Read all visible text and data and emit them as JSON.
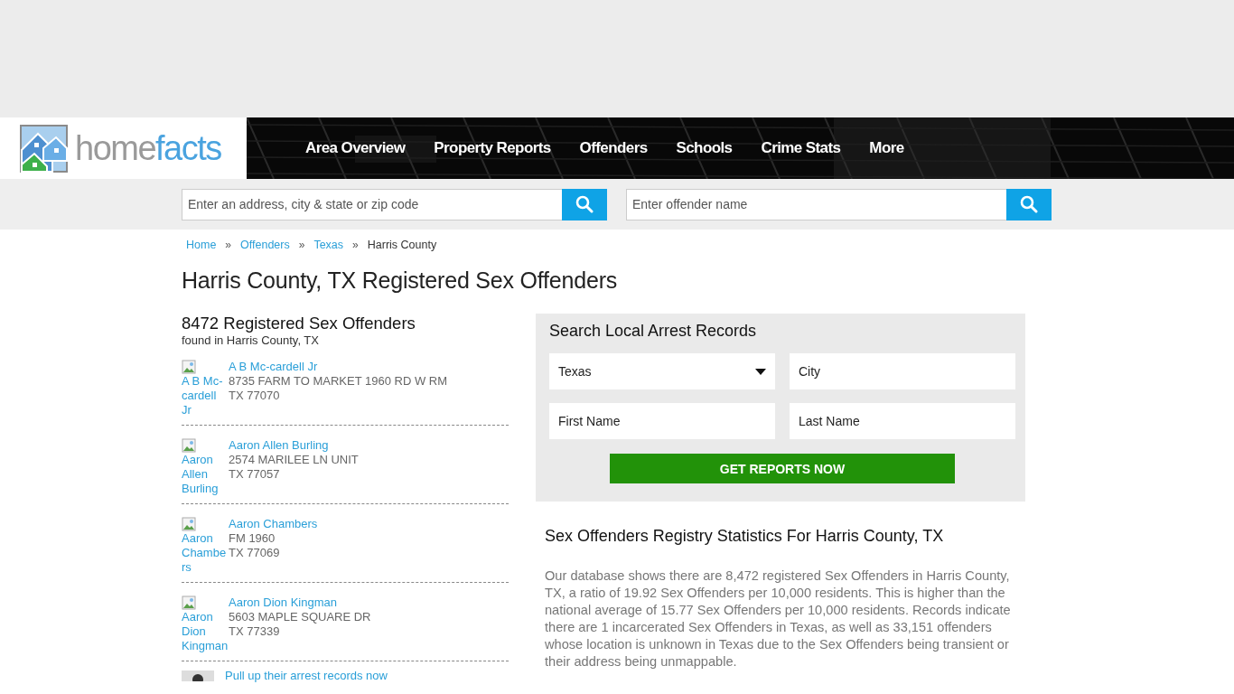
{
  "logo": {
    "parts": [
      "home",
      "facts"
    ]
  },
  "nav": [
    "Area Overview",
    "Property Reports",
    "Offenders",
    "Schools",
    "Crime Stats",
    "More"
  ],
  "search_bar": {
    "address_placeholder": "Enter an address, city & state or zip code",
    "offender_placeholder": "Enter offender name"
  },
  "breadcrumbs": [
    {
      "label": "Home",
      "kind": "link"
    },
    {
      "label": "Offenders",
      "kind": "link"
    },
    {
      "label": "Texas",
      "kind": "link"
    },
    {
      "label": "Harris County",
      "kind": "current"
    }
  ],
  "breadcrumb_separator": "»",
  "page_title": "Harris County, TX Registered Sex Offenders",
  "count_heading": "8472 Registered Sex Offenders",
  "count_subtitle": "found in Harris County, TX",
  "offenders": [
    {
      "alt": "A B Mc-cardell Jr",
      "name": "A B Mc-cardell Jr",
      "address": "8735 FARM TO MARKET 1960 RD W RM",
      "city": "TX 77070"
    },
    {
      "alt": "Aaron Allen Burling",
      "name": "Aaron Allen Burling",
      "address": "2574 MARILEE LN UNIT",
      "city": "TX 77057"
    },
    {
      "alt": "Aaron Chambers",
      "name": "Aaron Chambers",
      "address": "FM 1960",
      "city": "TX 77069"
    },
    {
      "alt": "Aaron Dion Kingman",
      "name": "Aaron Dion Kingman",
      "address": "5603 MAPLE SQUARE DR",
      "city": "TX 77339"
    }
  ],
  "promo_link": "Pull up their arrest records now",
  "arrest_search": {
    "title": "Search Local Arrest Records",
    "state": "Texas",
    "city_placeholder": "City",
    "first_name_placeholder": "First Name",
    "last_name_placeholder": "Last Name",
    "button": "GET REPORTS NOW"
  },
  "statistics": {
    "title": "Sex Offenders Registry Statistics For Harris County, TX",
    "text": "Our database shows there are 8,472 registered Sex Offenders in Harris County, TX, a ratio of 19.92 Sex Offenders per 10,000 residents. This is higher than the national average of 15.77 Sex Offenders per 10,000 residents. Records indicate there are 1 incarcerated Sex Offenders in Texas, as well as 33,151 offenders whose location is unknown in Texas due to the Sex Offenders being transient or their address being unmappable."
  }
}
